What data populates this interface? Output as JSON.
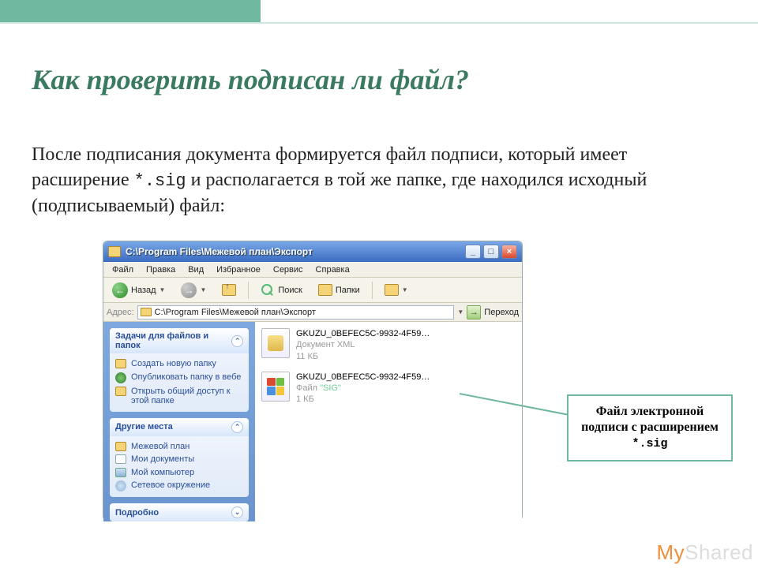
{
  "slide": {
    "title": "Как проверить подписан ли файл?",
    "para_before": "После подписания документа формируется файл подписи, который имеет расширение ",
    "ext": "*.sig",
    "para_after": " и располагается в той же папке, где находился исходный (подписываемый) файл:"
  },
  "explorer": {
    "title": "C:\\Program Files\\Межевой план\\Экспорт",
    "menus": [
      "Файл",
      "Правка",
      "Вид",
      "Избранное",
      "Сервис",
      "Справка"
    ],
    "nav": {
      "back": "Назад",
      "search": "Поиск",
      "folders": "Папки"
    },
    "address": {
      "label": "Адрес:",
      "value": "C:\\Program Files\\Межевой план\\Экспорт",
      "go": "Переход"
    },
    "panels": {
      "tasks": {
        "title": "Задачи для файлов и папок",
        "items": [
          "Создать новую папку",
          "Опубликовать папку в вебе",
          "Открыть общий доступ к этой папке"
        ]
      },
      "places": {
        "title": "Другие места",
        "items": [
          "Межевой план",
          "Мои документы",
          "Мой компьютер",
          "Сетевое окружение"
        ]
      },
      "details": {
        "title": "Подробно"
      }
    },
    "files": [
      {
        "name": "GKUZU_0BEFEC5C-9932-4F59…",
        "type": "Документ XML",
        "size": "11 КБ",
        "icon": "xml"
      },
      {
        "name": "GKUZU_0BEFEC5C-9932-4F59…",
        "type_prefix": "Файл ",
        "type_hl": "\"SIG\"",
        "size": "1 КБ",
        "icon": "win"
      }
    ]
  },
  "callout": {
    "line1": "Файл электронной подписи с расширением ",
    "ext": "*.sig"
  },
  "watermark": {
    "my": "My",
    "shared": "Shared"
  }
}
